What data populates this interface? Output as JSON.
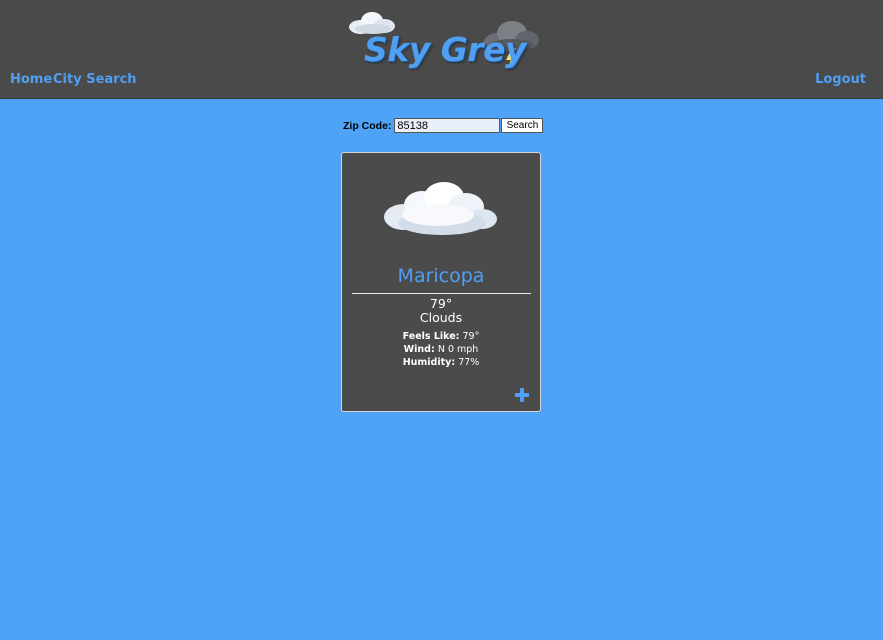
{
  "header": {
    "logo_text": "Sky Grey",
    "logo_icons": [
      "cloud-icon",
      "storm-cloud-icon"
    ],
    "nav": {
      "home": "Home",
      "city_search": "City Search",
      "logout": "Logout"
    }
  },
  "search": {
    "label": "Zip Code:",
    "value": "85138",
    "button": "Search"
  },
  "weather_card": {
    "icon": "cloud-icon",
    "city": "Maricopa",
    "temperature": "79°",
    "condition": "Clouds",
    "feels_like_label": "Feels Like:",
    "feels_like_value": "79°",
    "wind_label": "Wind:",
    "wind_value": "N 0 mph",
    "humidity_label": "Humidity:",
    "humidity_value": "77%",
    "add_icon": "plus-icon"
  },
  "colors": {
    "background": "#4fa3f7",
    "header": "#4a4a4a",
    "card": "#4b4b4b",
    "accent": "#4f9ff3"
  }
}
